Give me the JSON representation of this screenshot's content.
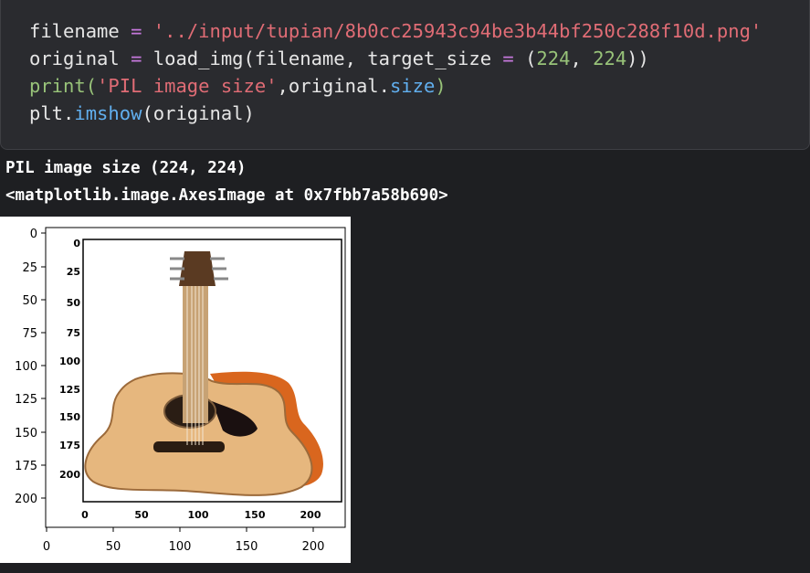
{
  "code": {
    "line1": {
      "var": "filename",
      "eq": " = ",
      "str": "'../input/tupian/8b0cc25943c94be3b44bf250c288f10d.png'"
    },
    "line2": {
      "pre": "original",
      "eq": " = ",
      "fn": "load_img(filename, target_size ",
      "eq2": "=",
      "sp": " (",
      "n1": "224",
      ",": ", ",
      "n2": "224",
      "close": "))"
    },
    "line3": {
      "fn": "print(",
      "str": "'PIL image size'",
      "mid": ",original.",
      "attr": "size",
      "close": ")"
    },
    "line4": {
      "pre": "plt.",
      "fn": "imshow",
      "args": "(original)"
    }
  },
  "output": {
    "line1": "PIL image size (224, 224)",
    "line2": "<matplotlib.image.AxesImage at 0x7fbb7a58b690>"
  },
  "figure": {
    "outer_yticks": [
      "0",
      "25",
      "50",
      "75",
      "100",
      "125",
      "150",
      "175",
      "200"
    ],
    "outer_xticks": [
      "0",
      "50",
      "100",
      "150",
      "200"
    ],
    "inner_yticks": [
      "0",
      "25",
      "50",
      "75",
      "100",
      "125",
      "150",
      "175",
      "200"
    ],
    "inner_xticks": [
      "0",
      "50",
      "100",
      "150",
      "200"
    ]
  },
  "colors": {
    "background": "#1e1f22",
    "cell": "#2a2b2f",
    "string": "#e06c75",
    "number": "#98c379",
    "operator": "#c678dd",
    "attr": "#61afef"
  }
}
